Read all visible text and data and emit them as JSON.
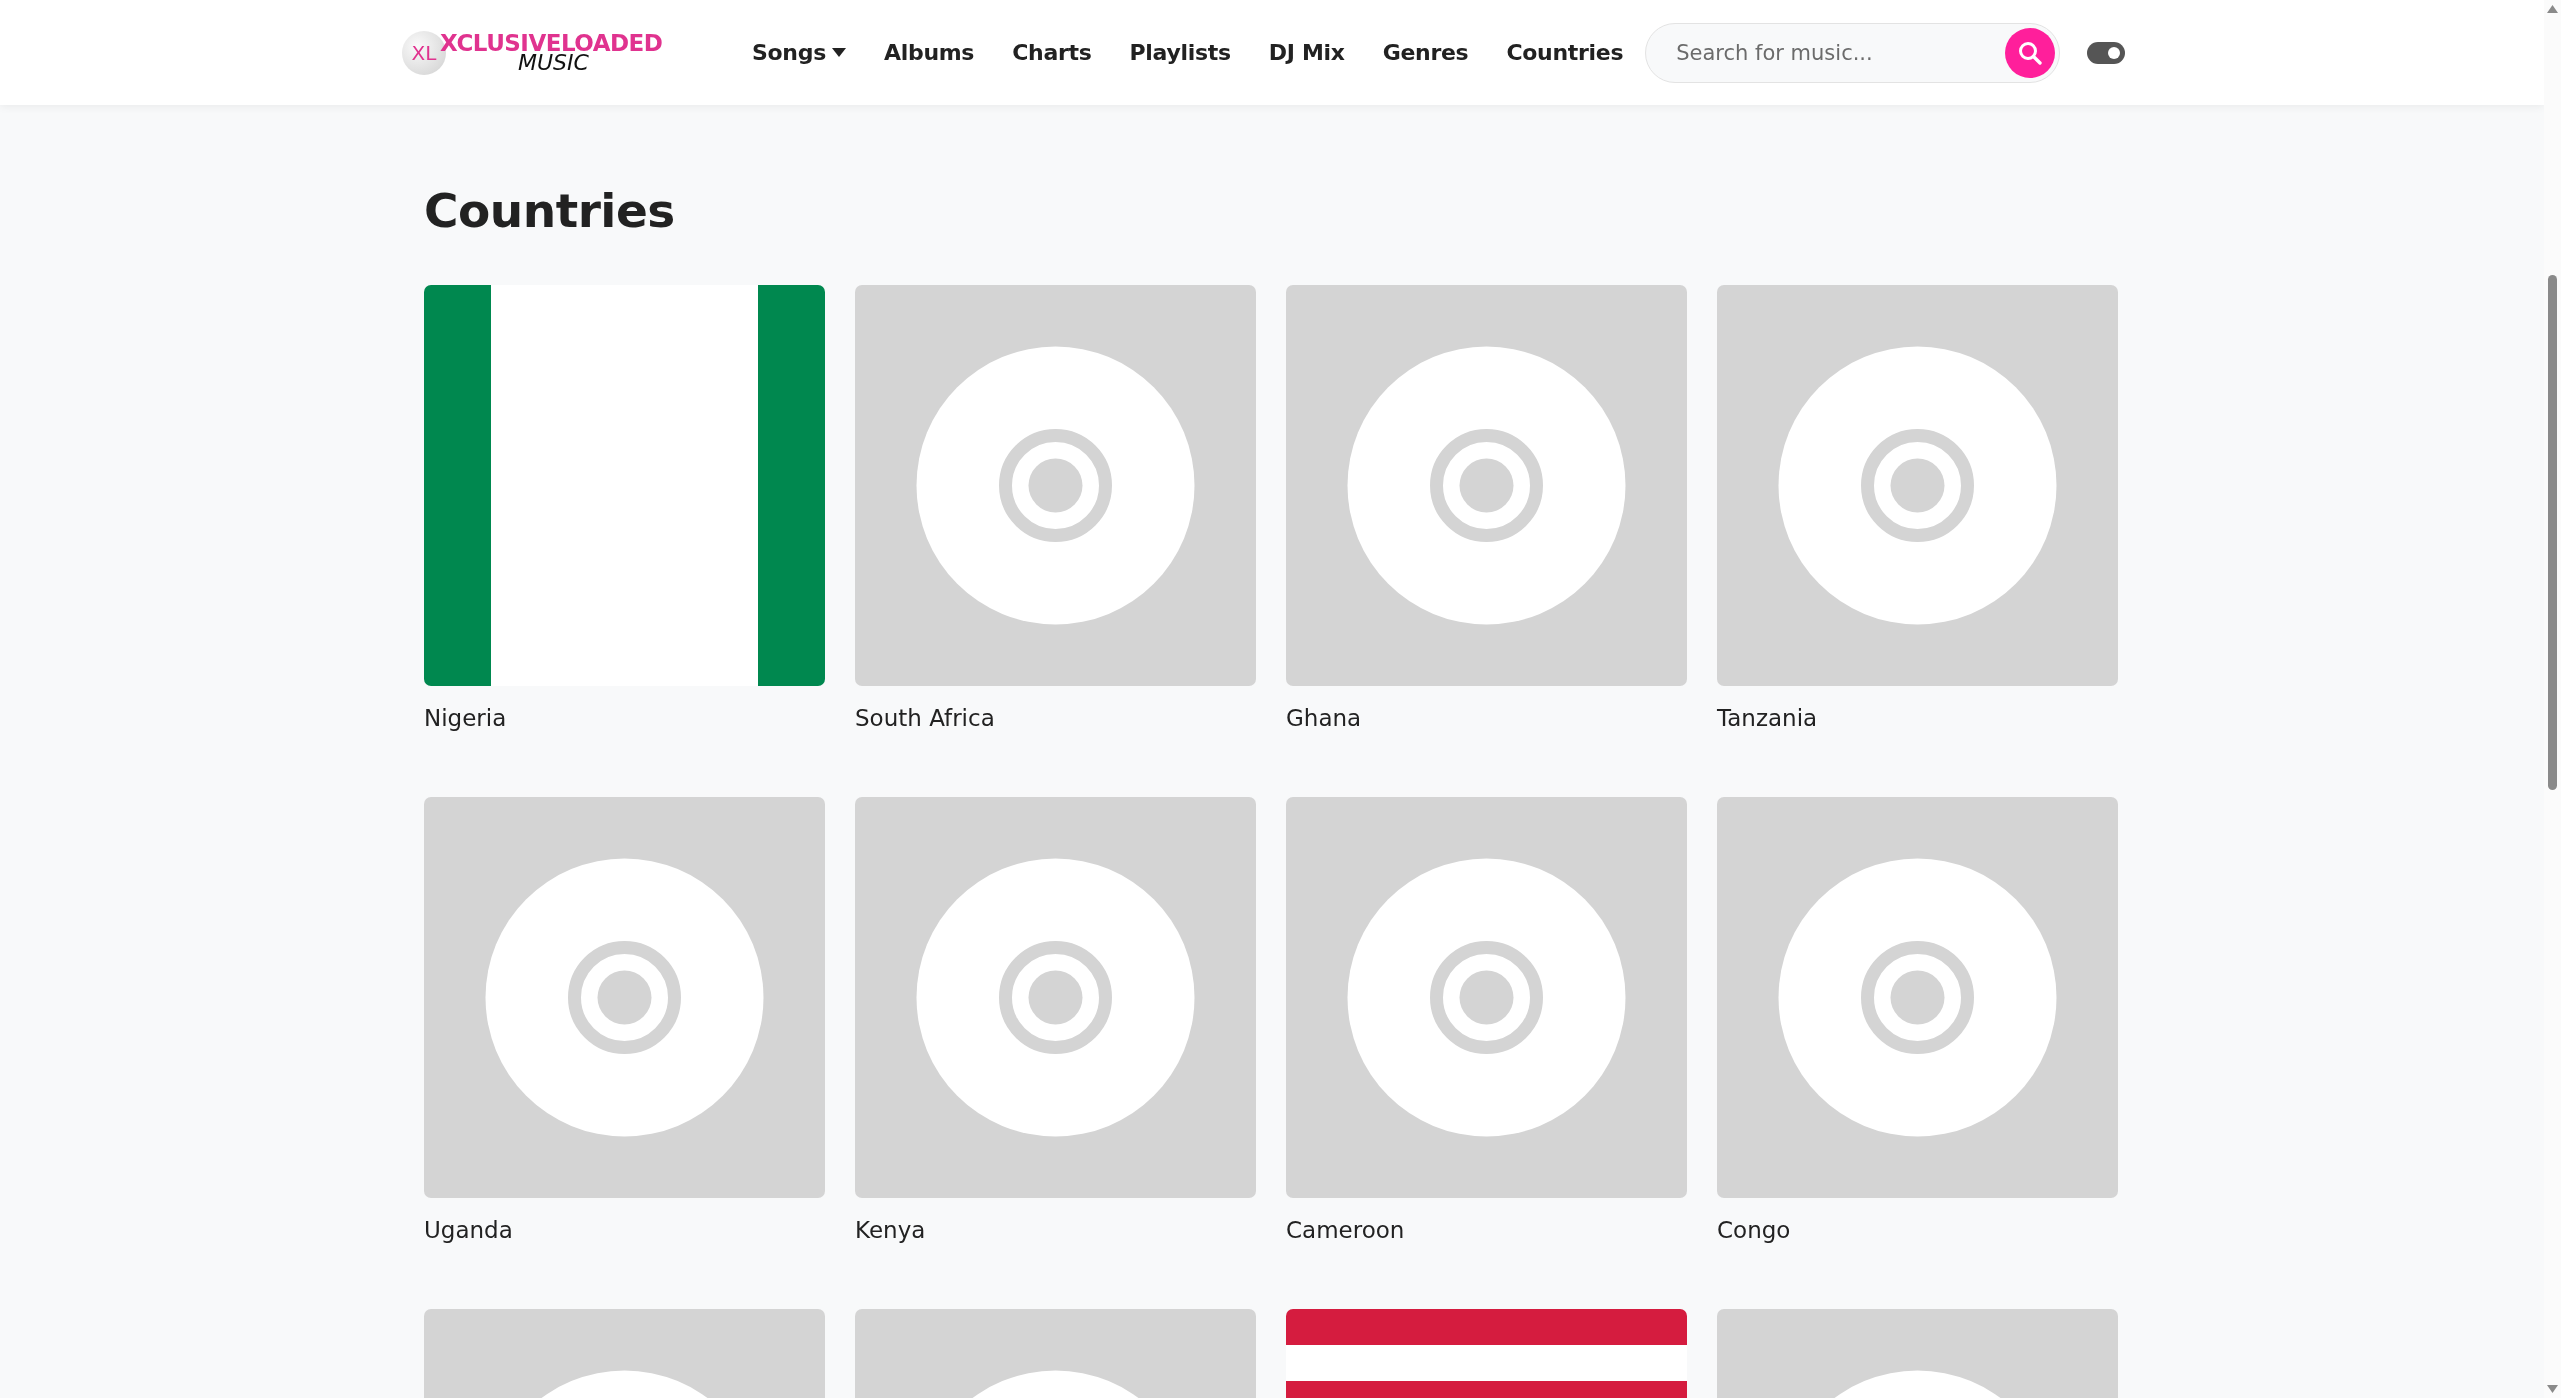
{
  "header": {
    "logo": {
      "badge": "XL",
      "name": "XCLUSIVELOADED",
      "tagline": "MUSIC"
    },
    "nav": [
      {
        "label": "Songs",
        "kind": "dropdown"
      },
      {
        "label": "Albums",
        "kind": "link"
      },
      {
        "label": "Charts",
        "kind": "link"
      },
      {
        "label": "Playlists",
        "kind": "link"
      },
      {
        "label": "DJ Mix",
        "kind": "link"
      },
      {
        "label": "Genres",
        "kind": "link"
      },
      {
        "label": "Countries",
        "kind": "link"
      }
    ],
    "search": {
      "placeholder": "Search for music..."
    },
    "theme_toggle": {
      "on": true
    }
  },
  "page": {
    "title": "Countries"
  },
  "countries": [
    {
      "name": "Nigeria",
      "image": {
        "kind": "vflag"
      }
    },
    {
      "name": "South Africa",
      "image": {
        "kind": "placeholder"
      }
    },
    {
      "name": "Ghana",
      "image": {
        "kind": "placeholder"
      }
    },
    {
      "name": "Tanzania",
      "image": {
        "kind": "placeholder"
      }
    },
    {
      "name": "Uganda",
      "image": {
        "kind": "placeholder"
      }
    },
    {
      "name": "Kenya",
      "image": {
        "kind": "placeholder"
      }
    },
    {
      "name": "Cameroon",
      "image": {
        "kind": "placeholder"
      }
    },
    {
      "name": "Congo",
      "image": {
        "kind": "placeholder"
      }
    },
    {
      "image": {
        "kind": "placeholder"
      }
    },
    {
      "image": {
        "kind": "placeholder"
      }
    },
    {
      "image": {
        "kind": "hflag"
      }
    },
    {
      "image": {
        "kind": "placeholder"
      }
    }
  ]
}
